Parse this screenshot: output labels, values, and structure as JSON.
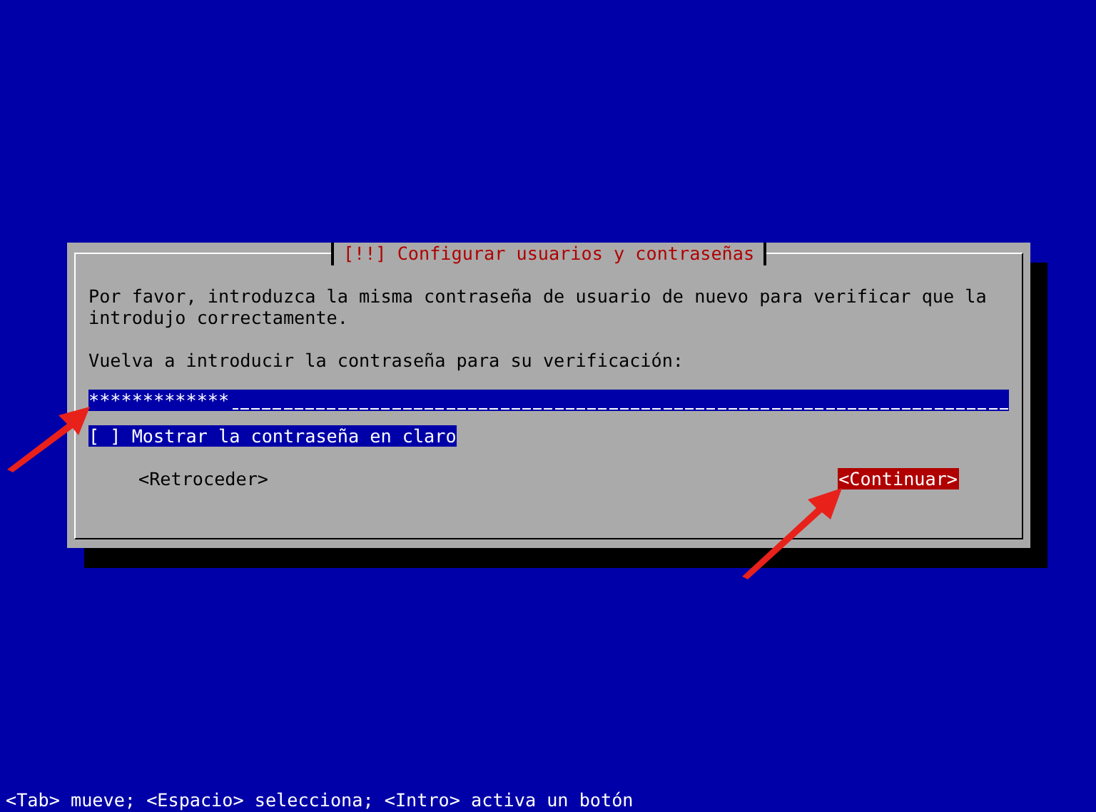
{
  "dialog": {
    "title": "[!!] Configurar usuarios y contraseñas",
    "message": "Por favor, introduzca la misma contraseña de usuario de nuevo para verificar que la introdujo correctamente.",
    "prompt": "Vuelva a introducir la contraseña para su verificación:",
    "password_field": {
      "value": "*************"
    },
    "checkbox": {
      "box": "[ ]",
      "label": "Mostrar la contraseña en claro",
      "focused": true
    },
    "buttons": [
      {
        "label": "<Retroceder>",
        "selected": false
      },
      {
        "label": "<Continuar>",
        "selected": true
      }
    ]
  },
  "status_bar": "<Tab> mueve; <Espacio> selecciona; <Intro> activa un botón"
}
